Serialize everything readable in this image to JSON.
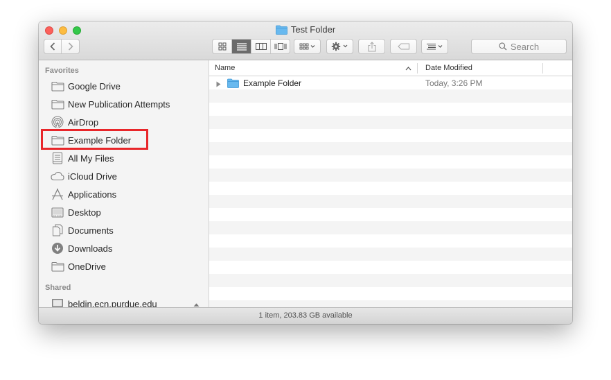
{
  "window": {
    "title": "Test Folder"
  },
  "toolbar": {
    "search_placeholder": "Search",
    "view_buttons": [
      "icon-view",
      "list-view",
      "column-view",
      "cover-flow-view"
    ]
  },
  "sidebar": {
    "favorites_title": "Favorites",
    "favorites": [
      {
        "label": "Google Drive",
        "icon": "folder-icon"
      },
      {
        "label": "New Publication Attempts",
        "icon": "folder-icon"
      },
      {
        "label": "AirDrop",
        "icon": "airdrop-icon"
      },
      {
        "label": "Example Folder",
        "icon": "folder-icon"
      },
      {
        "label": "All My Files",
        "icon": "all-files-icon"
      },
      {
        "label": "iCloud Drive",
        "icon": "cloud-icon"
      },
      {
        "label": "Applications",
        "icon": "applications-icon"
      },
      {
        "label": "Desktop",
        "icon": "desktop-icon"
      },
      {
        "label": "Documents",
        "icon": "documents-icon"
      },
      {
        "label": "Downloads",
        "icon": "download-icon"
      },
      {
        "label": "OneDrive",
        "icon": "folder-icon"
      }
    ],
    "shared_title": "Shared",
    "shared": [
      {
        "label": "beldin.ecn.purdue.edu",
        "icon": "server-icon"
      }
    ],
    "highlighted_item": "Example Folder",
    "highlight_color": "#e8262a"
  },
  "list": {
    "columns": [
      "Name",
      "Date Modified"
    ],
    "rows": [
      {
        "name": "Example Folder",
        "date": "Today, 3:26 PM"
      }
    ]
  },
  "statusbar": {
    "text": "1 item, 203.83 GB available"
  },
  "colors": {
    "folder_blue": "#5ab4f0",
    "accent_red": "#e8262a"
  }
}
